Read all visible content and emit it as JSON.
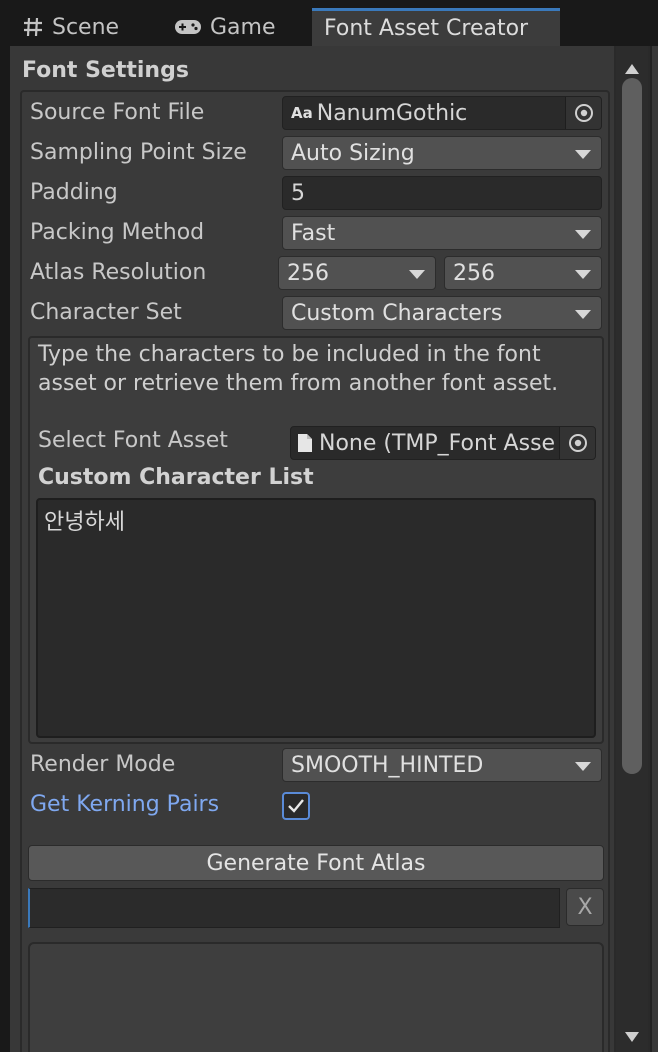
{
  "tabs": [
    {
      "label": "Scene",
      "icon": "grid-icon"
    },
    {
      "label": "Game",
      "icon": "gamepad-icon"
    },
    {
      "label": "Font Asset Creator",
      "active": true
    }
  ],
  "section_title": "Font Settings",
  "fields": {
    "source_font_file": {
      "label": "Source Font File",
      "value": "NanumGothic",
      "icon_text": "Aa"
    },
    "sampling_point_size": {
      "label": "Sampling Point Size",
      "value": "Auto Sizing"
    },
    "padding": {
      "label": "Padding",
      "value": "5"
    },
    "packing_method": {
      "label": "Packing Method",
      "value": "Fast"
    },
    "atlas_resolution": {
      "label": "Atlas Resolution",
      "width": "256",
      "height": "256"
    },
    "character_set": {
      "label": "Character Set",
      "value": "Custom Characters"
    }
  },
  "custom_set": {
    "help_text": "Type the characters to be included in the font asset or retrieve them from another font asset.",
    "select_font_asset_label": "Select Font Asset",
    "select_font_asset_value": "None (TMP_Font Asset)",
    "custom_character_list_label": "Custom Character List",
    "custom_character_list_value": "안녕하세"
  },
  "render_mode": {
    "label": "Render Mode",
    "value": "SMOOTH_HINTED"
  },
  "kerning": {
    "label": "Get Kerning Pairs",
    "checked": true
  },
  "generate_button": "Generate Font Atlas",
  "clear_button": "X",
  "colors": {
    "accent": "#3a79bb",
    "link": "#7fa8f0",
    "panel": "#383838"
  }
}
